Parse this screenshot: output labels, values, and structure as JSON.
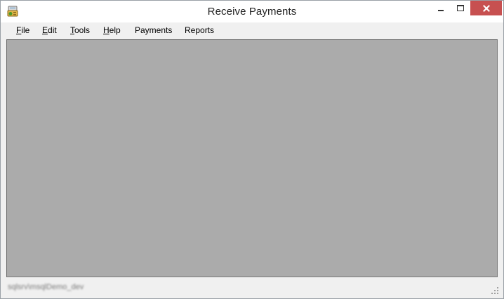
{
  "window": {
    "title": "Receive Payments"
  },
  "menu": {
    "items": [
      {
        "pre": "",
        "u": "F",
        "post": "ile"
      },
      {
        "pre": "",
        "u": "E",
        "post": "dit"
      },
      {
        "pre": "",
        "u": "T",
        "post": "ools"
      },
      {
        "pre": "",
        "u": "H",
        "post": "elp"
      },
      {
        "pre": "Payments",
        "u": "",
        "post": ""
      },
      {
        "pre": "Reports",
        "u": "",
        "post": ""
      }
    ]
  },
  "status": {
    "text": "sqlsrv\\msqlDemo_dev"
  },
  "colors": {
    "client_background": "#ababab",
    "close_button": "#c75050",
    "chrome": "#f0f0f0"
  },
  "icons": {
    "app": "cash-register-icon",
    "minimize": "minimize-icon",
    "maximize": "maximize-icon",
    "close": "close-icon",
    "grip": "resize-grip-icon"
  }
}
